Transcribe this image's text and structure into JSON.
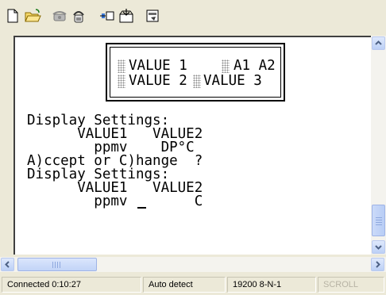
{
  "toolbar": {
    "buttons": [
      {
        "icon": "new-document-icon"
      },
      {
        "icon": "open-folder-icon"
      },
      {
        "icon": "disconnect-phone-icon"
      },
      {
        "icon": "connect-phone-icon"
      },
      {
        "icon": "send-file-icon"
      },
      {
        "icon": "receive-file-icon"
      },
      {
        "icon": "properties-icon"
      }
    ]
  },
  "terminal": {
    "box": {
      "row1_left": "VALUE 1",
      "row1_right": "A1 A2",
      "row2_left": "VALUE 2",
      "row2_right": "VALUE 3"
    },
    "lines": [
      "Display Settings:",
      "      VALUE1   VALUE2",
      "        ppmv    DP°C",
      "A)ccept or C)hange  ?",
      "Display Settings:",
      "      VALUE1   VALUE2",
      "        ppmv        C"
    ]
  },
  "statusbar": {
    "connection": "Connected 0:10:27",
    "detect": "Auto detect",
    "port": "19200 8-N-1",
    "scroll": "SCROLL"
  },
  "colors": {
    "chrome": "#ece9d8",
    "scrollbar_accent": "#bcd0f6",
    "text": "#000000"
  }
}
